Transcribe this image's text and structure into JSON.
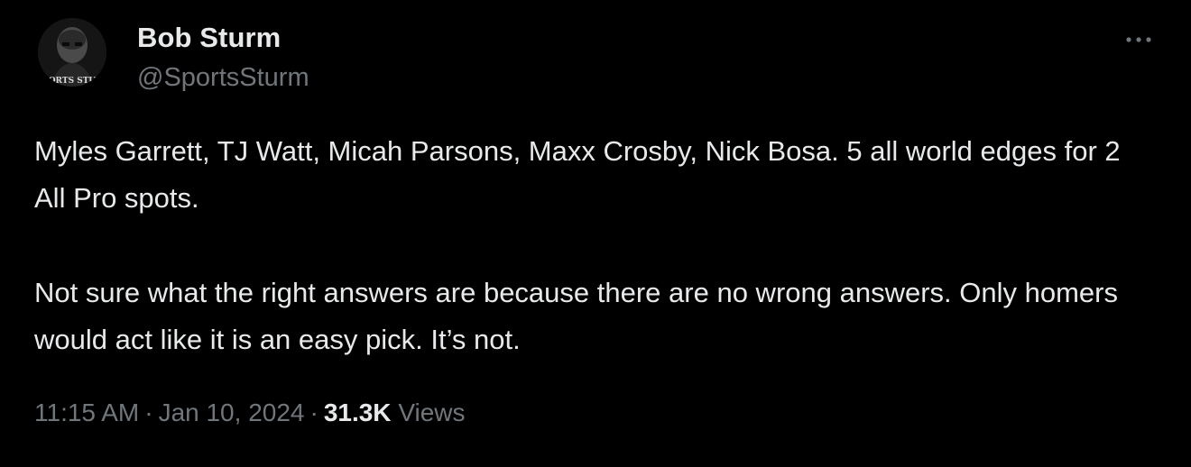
{
  "author": {
    "name": "Bob Sturm",
    "handle": "@SportsSturm",
    "avatar_text": "ORTS STU"
  },
  "more_icon": "more-horizontal-icon",
  "tweet": {
    "paragraphs": [
      "Myles Garrett, TJ Watt, Micah Parsons, Maxx Crosby, Nick Bosa. 5 all world edges for 2 All Pro spots.",
      "Not sure what the right answers are because there are no wrong answers. Only homers would act like it is an easy pick. It’s not."
    ]
  },
  "meta": {
    "time": "11:15 AM",
    "separator": "·",
    "date": "Jan 10, 2024",
    "views_count": "31.3K",
    "views_label": "Views"
  },
  "colors": {
    "background": "#000000",
    "primary_text": "#e7e9ea",
    "secondary_text": "#71767b"
  }
}
